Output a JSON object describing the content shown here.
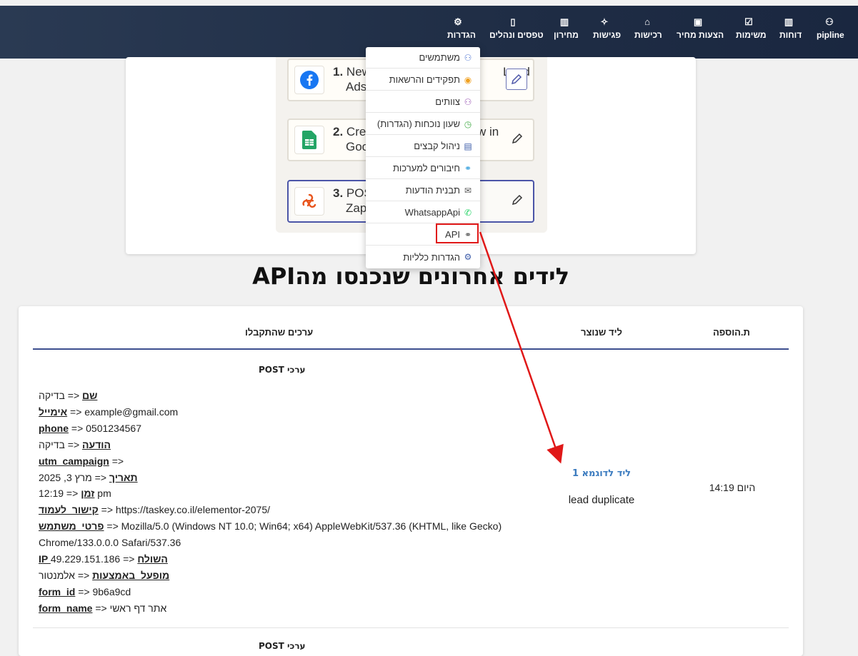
{
  "nav": {
    "items": [
      {
        "label": "pipline",
        "icon": "pipeline-icon"
      },
      {
        "label": "דוחות",
        "icon": "bar-chart-icon"
      },
      {
        "label": "משימות",
        "icon": "checkbox-icon"
      },
      {
        "label": "הצעות מחיר",
        "icon": "document-icon"
      },
      {
        "label": "רכישות",
        "icon": "purchase-icon"
      },
      {
        "label": "פגישות",
        "icon": "handshake-icon"
      },
      {
        "label": "מחירון",
        "icon": "barcode-icon"
      },
      {
        "label": "טפסים ונהלים",
        "icon": "book-icon"
      },
      {
        "label": "הגדרות",
        "icon": "gear-icon"
      }
    ]
  },
  "zap": {
    "steps": [
      {
        "num": "1.",
        "line1": "New",
        "line1_end": "Lead",
        "line2": "Ads"
      },
      {
        "num": "2.",
        "line1": "Cre",
        "line1_end": "w in",
        "line2": "Goo"
      },
      {
        "num": "3.",
        "line1": "POS",
        "line1_end": "",
        "line2": "Zap"
      }
    ]
  },
  "dropdown": {
    "items": [
      {
        "label": "משתמשים",
        "icon": "users-icon",
        "icon_color": "#5b7fd6"
      },
      {
        "label": "תפקידים והרשאות",
        "icon": "eye-icon",
        "icon_color": "#f0a020"
      },
      {
        "label": "צוותים",
        "icon": "team-icon",
        "icon_color": "#9b59b6"
      },
      {
        "label": "שעון נוכחות (הגדרות)",
        "icon": "clock-icon",
        "icon_color": "#4caf50"
      },
      {
        "label": "ניהול קבצים",
        "icon": "file-icon",
        "icon_color": "#3b5ba9"
      },
      {
        "label": "חיבורים למערכות",
        "icon": "link-icon",
        "icon_color": "#2d9cdb"
      },
      {
        "label": "תבנית הודעות",
        "icon": "envelope-icon",
        "icon_color": "#555555"
      },
      {
        "label": "WhatsappApi",
        "icon": "whatsapp-icon",
        "icon_color": "#25d366"
      },
      {
        "label": "API",
        "icon": "link-icon",
        "icon_color": "#555555"
      },
      {
        "label": "הגדרות כלליות",
        "icon": "gear-icon",
        "icon_color": "#3b5ba9"
      }
    ]
  },
  "heading": "לידים אחרונים שנכנסו מהAPI",
  "table": {
    "headers": {
      "added": "ת.הוספה",
      "lead": "ליד שנוצר",
      "values": "ערכים שהתקבלו"
    },
    "post_title": "ערכי POST",
    "rows": [
      {
        "added": "היום 14:19",
        "lead_link": "ליד לדוגמא 1",
        "lead_status": "lead duplicate",
        "values": [
          {
            "key": "שם",
            "val": " <= בדיקה"
          },
          {
            "key": "אימייל",
            "val": " => example@gmail.com"
          },
          {
            "key": "phone",
            "val": " => 0501234567"
          },
          {
            "key": "הודעה",
            "val": " <= בדיקה"
          },
          {
            "key": "utm_campaign",
            "val": " =>"
          },
          {
            "key": "תאריך",
            "val": " <= מרץ 3, 2025"
          },
          {
            "key": "זמן",
            "val": " <= 12:19 pm"
          },
          {
            "key": "קישור_לעמוד",
            "val": " => https://taskey.co.il/elementor-2075/"
          },
          {
            "key": "פרטי_משתמש",
            "val": " => Mozilla/5.0 (Windows NT 10.0; Win64; x64) AppleWebKit/537.36 (KHTML, like Gecko)"
          },
          {
            "key": "",
            "val": "Chrome/133.0.0.0 Safari/537.36"
          },
          {
            "key": "IP השולח",
            "val": " <= 49.229.151.186"
          },
          {
            "key": "מופעל_באמצעות",
            "val": " <= אלמנטור"
          },
          {
            "key": "form_id",
            "val": " => 9b6a9cd"
          },
          {
            "key": "form_name",
            "val": " => אתר דף ראשי"
          }
        ]
      }
    ]
  },
  "annotation_color": "#e01818"
}
